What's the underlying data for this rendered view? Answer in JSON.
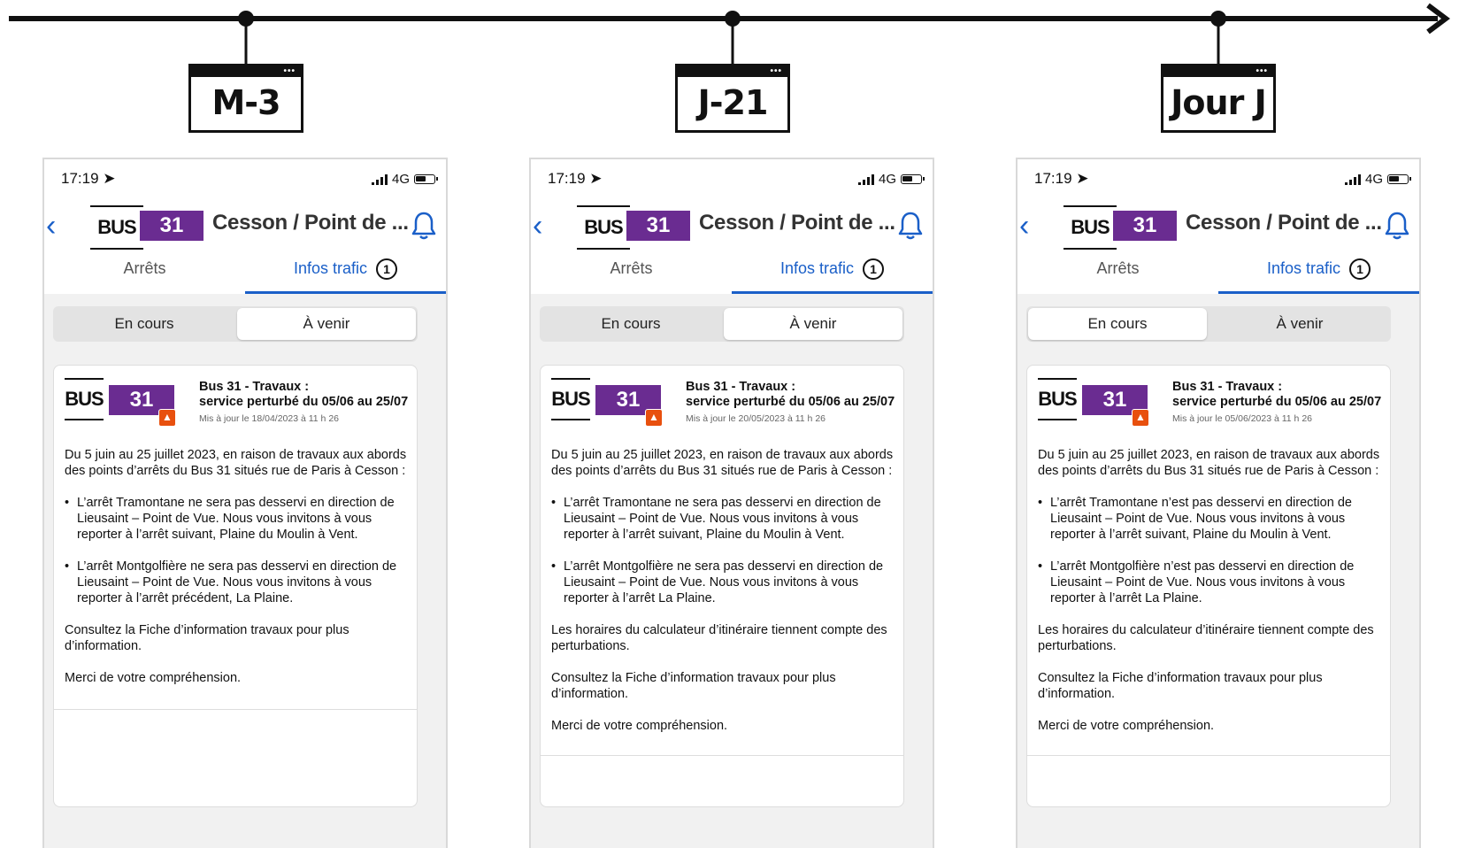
{
  "timeline": {
    "milestones": [
      {
        "label": "M-3"
      },
      {
        "label": "J-21"
      },
      {
        "label": "Jour J"
      }
    ]
  },
  "phones": [
    {
      "status": {
        "time": "17:19",
        "network": "4G"
      },
      "header": {
        "bus": "BUS",
        "line": "31",
        "title": "Cesson / Point de ..."
      },
      "tabs": {
        "stops": "Arrêts",
        "traffic": "Infos trafic",
        "traffic_count": "1"
      },
      "segment": {
        "current": "En cours",
        "upcoming": "À venir",
        "active": "upcoming"
      },
      "card": {
        "bus": "BUS",
        "line": "31",
        "title_1": "Bus 31 - Travaux :",
        "title_2": "service perturbé du 05/06 au 25/07",
        "updated": "Mis à jour le 18/04/2023 à 11 h 26",
        "intro": "Du 5 juin au 25 juillet 2023, en raison de travaux aux abords des points d’arrêts du Bus 31 situés rue de Paris à Cesson :",
        "bullet_1": "L’arrêt Tramontane ne sera pas desservi en direction de Lieusaint – Point de Vue. Nous vous invitons à vous reporter à l’arrêt suivant, Plaine du Moulin à Vent.",
        "bullet_2": "L’arrêt Montgolfière ne sera pas desservi en direction de Lieusaint – Point de Vue. Nous vous invitons à vous reporter à l’arrêt précédent, La Plaine.",
        "schedules": "",
        "info": "Consultez la Fiche d’information travaux pour plus d’information.",
        "thanks": "Merci de votre compréhension."
      }
    },
    {
      "status": {
        "time": "17:19",
        "network": "4G"
      },
      "header": {
        "bus": "BUS",
        "line": "31",
        "title": "Cesson / Point de ..."
      },
      "tabs": {
        "stops": "Arrêts",
        "traffic": "Infos trafic",
        "traffic_count": "1"
      },
      "segment": {
        "current": "En cours",
        "upcoming": "À venir",
        "active": "upcoming"
      },
      "card": {
        "bus": "BUS",
        "line": "31",
        "title_1": "Bus 31 - Travaux :",
        "title_2": "service perturbé du 05/06 au 25/07",
        "updated": "Mis à jour le 20/05/2023 à 11 h 26",
        "intro": "Du 5 juin au 25 juillet 2023, en raison de travaux aux abords des points d’arrêts du Bus 31 situés rue de Paris à Cesson :",
        "bullet_1": "L’arrêt Tramontane ne sera pas desservi en direction de Lieusaint – Point de Vue. Nous vous invitons à vous reporter à l’arrêt suivant, Plaine du Moulin à Vent.",
        "bullet_2": "L’arrêt Montgolfière ne sera pas desservi en direction de Lieusaint – Point de Vue. Nous vous invitons à vous reporter à l’arrêt La Plaine.",
        "schedules": "Les horaires du calculateur d’itinéraire tiennent compte des perturbations.",
        "info": "Consultez la Fiche d’information travaux pour plus d’information.",
        "thanks": "Merci de votre compréhension."
      }
    },
    {
      "status": {
        "time": "17:19",
        "network": "4G"
      },
      "header": {
        "bus": "BUS",
        "line": "31",
        "title": "Cesson / Point de ..."
      },
      "tabs": {
        "stops": "Arrêts",
        "traffic": "Infos trafic",
        "traffic_count": "1"
      },
      "segment": {
        "current": "En cours",
        "upcoming": "À venir",
        "active": "current"
      },
      "card": {
        "bus": "BUS",
        "line": "31",
        "title_1": "Bus 31 - Travaux :",
        "title_2": "service perturbé du 05/06 au 25/07",
        "updated": "Mis à jour le 05/06/2023 à 11 h 26",
        "intro": "Du 5 juin au 25 juillet 2023, en raison de travaux aux abords des points d’arrêts du Bus 31 situés rue de Paris à Cesson :",
        "bullet_1": "L’arrêt Tramontane n’est pas desservi en direction de Lieusaint – Point de Vue. Nous vous invitons à vous reporter à l’arrêt suivant, Plaine du Moulin à Vent.",
        "bullet_2": "L’arrêt Montgolfière n’est pas desservi en direction de Lieusaint – Point de Vue. Nous vous invitons à vous reporter à l’arrêt La Plaine.",
        "schedules": "Les horaires du calculateur d’itinéraire tiennent compte des perturbations.",
        "info": "Consultez la Fiche d’information travaux pour plus d’information.",
        "thanks": "Merci de votre compréhension."
      }
    }
  ],
  "colors": {
    "accent_blue": "#1a5fc8",
    "line_purple": "#6a2c91",
    "warning_orange": "#e8500e"
  },
  "icons": [
    "arrow-right-icon",
    "navigation-arrow-icon",
    "signal-icon",
    "battery-icon",
    "chevron-left-icon",
    "bell-icon",
    "roadwork-cone-icon"
  ]
}
